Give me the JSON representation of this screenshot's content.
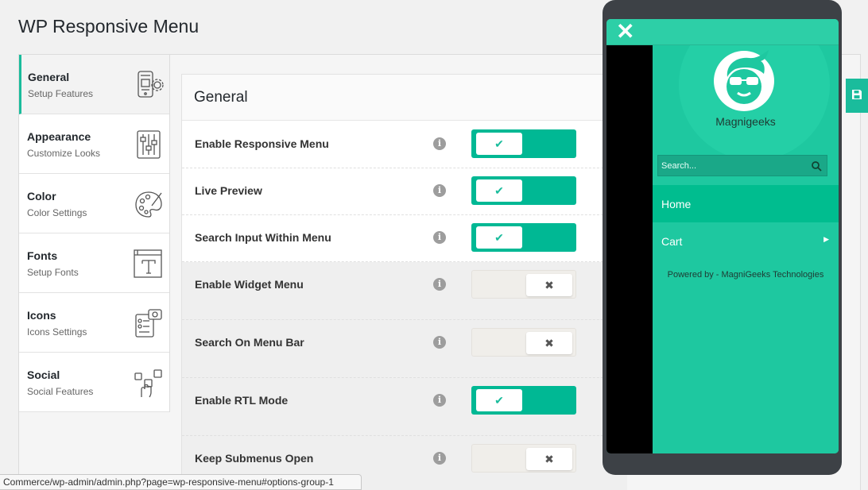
{
  "page": {
    "title": "WP Responsive Menu"
  },
  "sidebar": {
    "items": [
      {
        "title": "General",
        "subtitle": "Setup Features",
        "icon": "mobile-settings-icon",
        "active": true
      },
      {
        "title": "Appearance",
        "subtitle": "Customize Looks",
        "icon": "sliders-icon",
        "active": false
      },
      {
        "title": "Color",
        "subtitle": "Color Settings",
        "icon": "palette-icon",
        "active": false
      },
      {
        "title": "Fonts",
        "subtitle": "Setup Fonts",
        "icon": "font-icon",
        "active": false
      },
      {
        "title": "Icons",
        "subtitle": "Icons Settings",
        "icon": "icons-grid-icon",
        "active": false
      },
      {
        "title": "Social",
        "subtitle": "Social Features",
        "icon": "social-hand-icon",
        "active": false
      }
    ]
  },
  "panel": {
    "title": "General",
    "settings": [
      {
        "label": "Enable Responsive Menu",
        "enabled": true
      },
      {
        "label": "Live Preview",
        "enabled": true
      },
      {
        "label": "Search Input Within Menu",
        "enabled": true
      },
      {
        "label": "Enable Widget Menu",
        "enabled": false
      },
      {
        "label": "Search On Menu Bar",
        "enabled": false
      },
      {
        "label": "Enable RTL Mode",
        "enabled": true
      },
      {
        "label": "Keep Submenus Open",
        "enabled": false
      }
    ],
    "info_glyph": "i",
    "on_glyph": "✔",
    "off_glyph": "✖"
  },
  "preview": {
    "close_glyph": "✕",
    "brand": "Magnigeeks",
    "search_placeholder": "Search...",
    "menu_items": [
      {
        "label": "Home",
        "active": true,
        "arrow": ""
      },
      {
        "label": "Cart",
        "active": false,
        "arrow": "▶"
      }
    ],
    "powered": "Powered by - MagniGeeks Technologies"
  },
  "statusbar": {
    "url": "Commerce/wp-admin/admin.php?page=wp-responsive-menu#options-group-1"
  },
  "colors": {
    "accent": "#1abc9c",
    "toggle_on": "#00b894",
    "menu_bg": "#1ec8a0",
    "phone": "#3d4146"
  }
}
